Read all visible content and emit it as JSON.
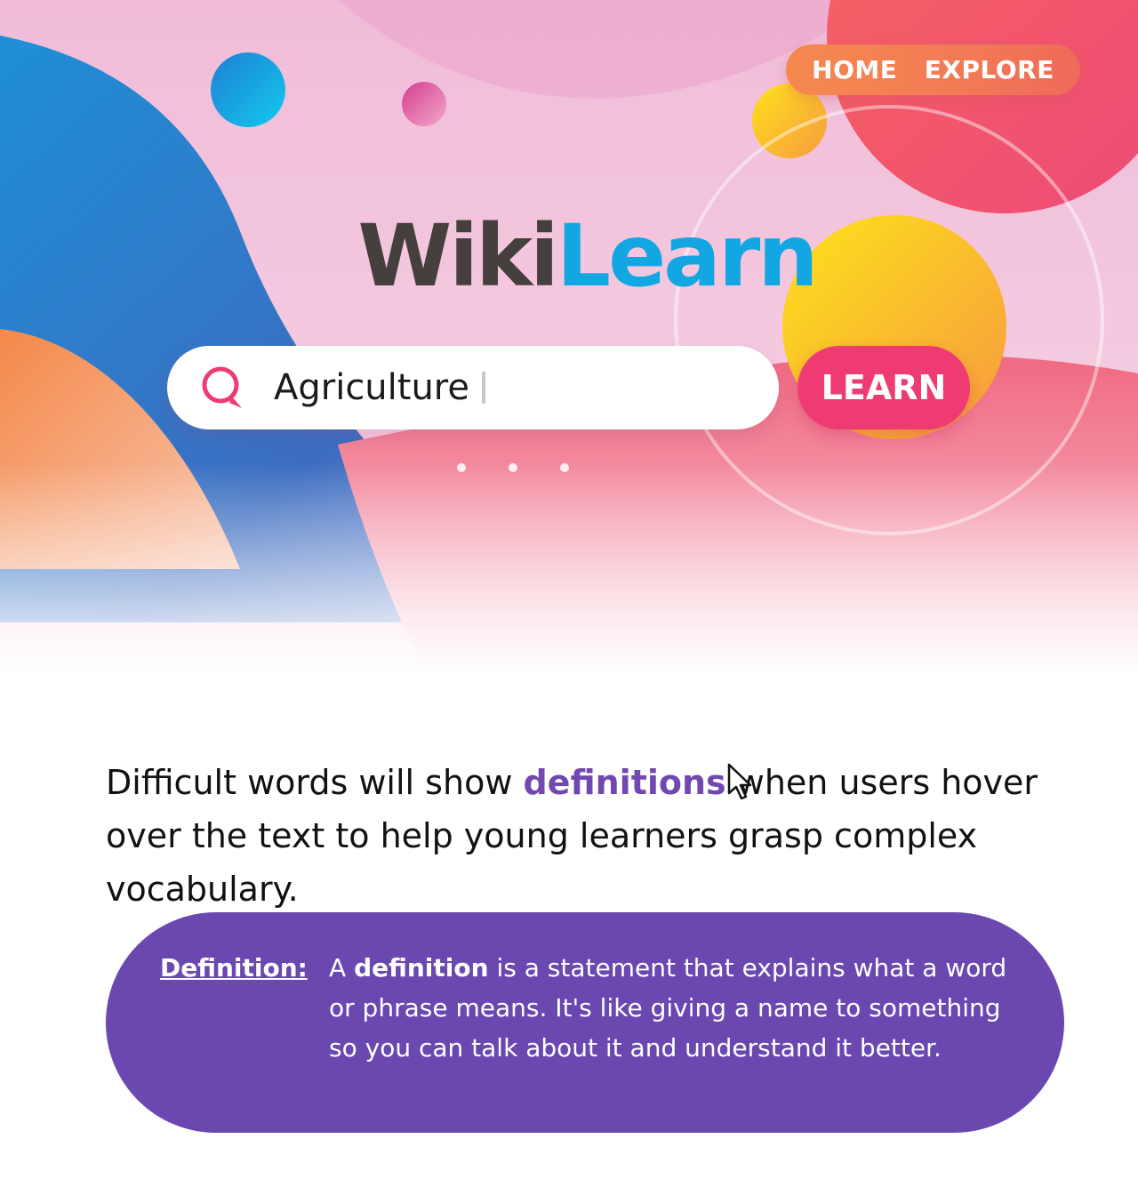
{
  "nav": {
    "home": "HOME",
    "explore": "EXPLORE"
  },
  "logo": {
    "part1": "Wiki",
    "part2": "Learn"
  },
  "search": {
    "value": "Agriculture",
    "button": "LEARN"
  },
  "carousel": {
    "dot_count": 3
  },
  "description": {
    "before": "Difficult words will show ",
    "term": "definitions",
    "after": " when users hover over the text to help young learners grasp complex vocabulary."
  },
  "definition": {
    "label": "Definition:",
    "prefix": "A ",
    "term": "definition",
    "text": " is a statement that explains what a word or phrase means. It's like giving a name to something so you can talk about it and understand it better."
  },
  "colors": {
    "nav_orange": "#f27a55",
    "logo_dark": "#453f3d",
    "logo_blue": "#12a6e2",
    "learn_pink": "#ee3b72",
    "term_purple": "#7048b0",
    "card_purple": "#6a48b0"
  }
}
